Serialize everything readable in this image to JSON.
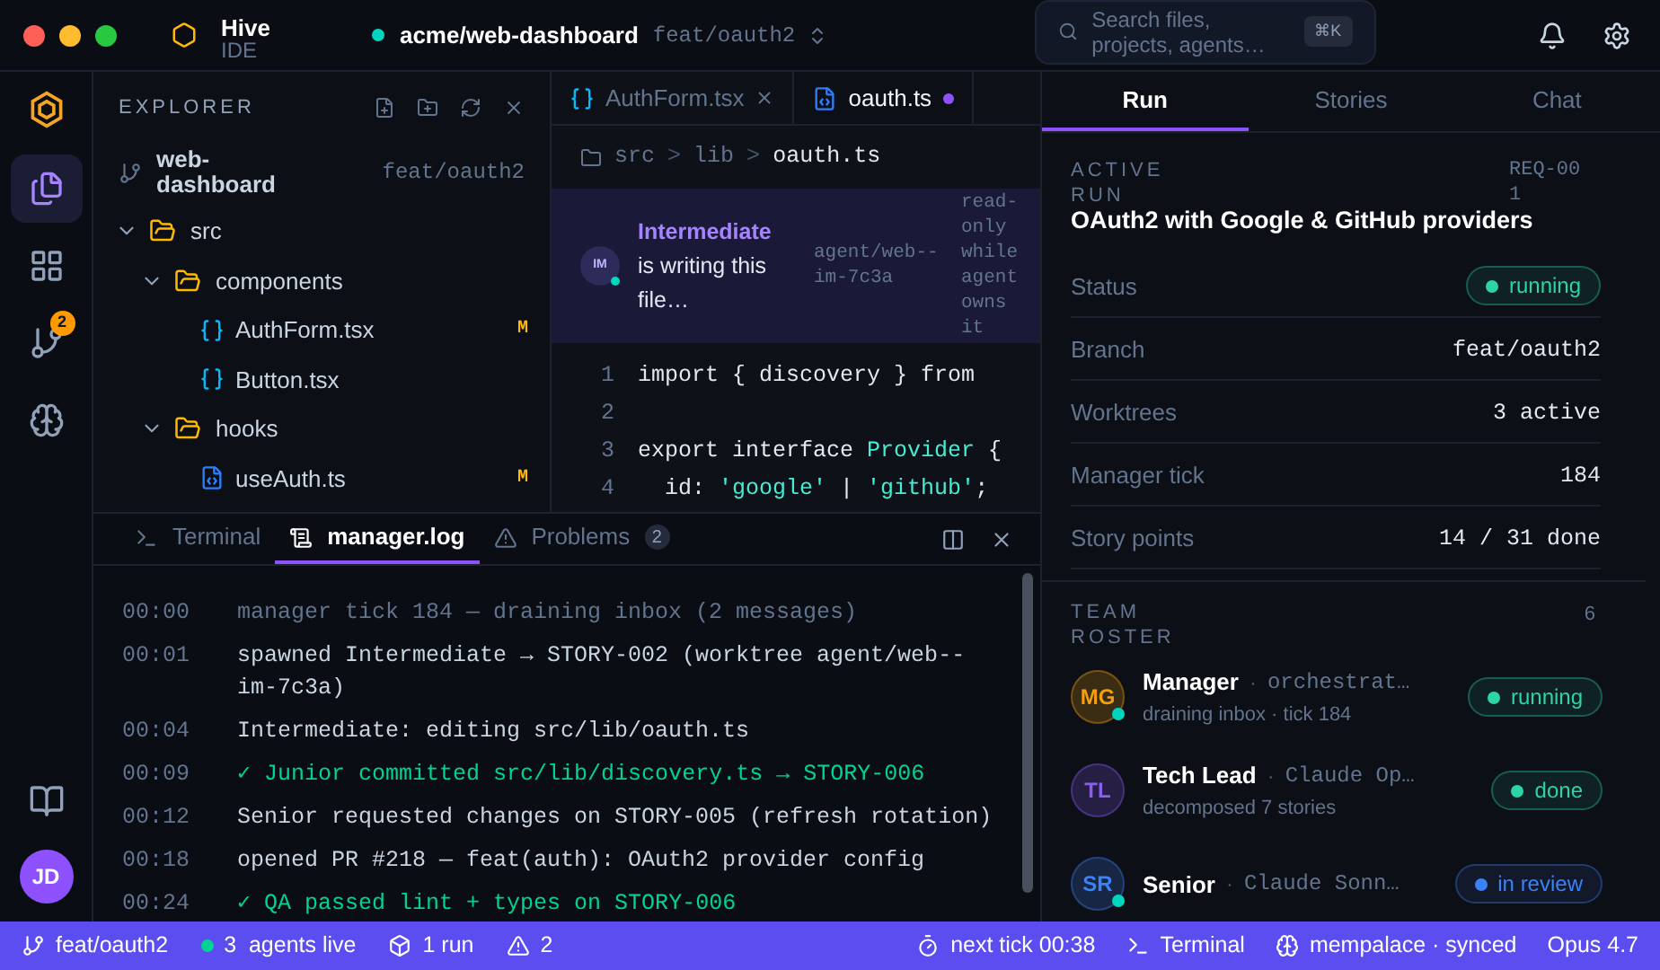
{
  "titlebar": {
    "app_name": "Hive",
    "app_sub": "IDE",
    "repo": "acme/web-dashboard",
    "branch": "feat/oauth2",
    "search": {
      "placeholder": "Search files, projects, agents…",
      "shortcut": "⌘K"
    }
  },
  "activity_bar": {
    "items": [
      {
        "kind": "files",
        "selected": true
      },
      {
        "kind": "grid",
        "selected": false
      },
      {
        "kind": "git",
        "selected": false,
        "badge": "2"
      },
      {
        "kind": "brain",
        "selected": false
      }
    ],
    "avatar": "JD"
  },
  "explorer": {
    "title": "EXPLORER",
    "project": "web-dashboard",
    "branch": "feat/oauth2",
    "tree": [
      {
        "name": "src",
        "kind": "folder",
        "expanded": true,
        "children": [
          {
            "name": "components",
            "kind": "folder",
            "expanded": true,
            "children": [
              {
                "name": "AuthForm.tsx",
                "kind": "tsx",
                "modified": "M"
              },
              {
                "name": "Button.tsx",
                "kind": "tsx"
              }
            ]
          },
          {
            "name": "hooks",
            "kind": "folder",
            "expanded": true,
            "children": [
              {
                "name": "useAuth.ts",
                "kind": "ts",
                "modified": "M"
              }
            ]
          }
        ]
      }
    ]
  },
  "editor": {
    "tabs": [
      {
        "name": "AuthForm.tsx",
        "kind": "tsx",
        "selected": false,
        "dirty": false
      },
      {
        "name": "oauth.ts",
        "kind": "ts",
        "selected": true,
        "dirty": true
      }
    ],
    "breadcrumb": [
      "src",
      "lib",
      "oauth.ts"
    ],
    "breadcrumb_separator": ">",
    "banner": {
      "avatar": "IM",
      "agent": "Intermediate",
      "message": "is writing this file…",
      "worktree": "agent/web--im-7c3a",
      "note": "read-only while agent owns it"
    },
    "lines": [
      {
        "number": "1",
        "tokens": [
          {
            "kind": "plain",
            "text": "import { discovery } from"
          }
        ]
      },
      {
        "number": "2"
      },
      {
        "number": "3",
        "tokens": [
          {
            "kind": "plain",
            "text": "export interface "
          },
          {
            "kind": "type",
            "text": "Provider"
          },
          {
            "kind": "plain",
            "text": " {"
          }
        ]
      },
      {
        "number": "4",
        "tokens": [
          {
            "kind": "plain",
            "text": "  id: "
          },
          {
            "kind": "string",
            "text": "'google'"
          },
          {
            "kind": "plain",
            "text": " | "
          },
          {
            "kind": "string",
            "text": "'github'"
          },
          {
            "kind": "plain",
            "text": ";"
          }
        ]
      }
    ]
  },
  "bottom_panel": {
    "tabs": [
      {
        "label": "Terminal",
        "kind": "terminal",
        "selected": false
      },
      {
        "label": "manager.log",
        "kind": "log",
        "selected": true
      },
      {
        "label": "Problems",
        "kind": "problems",
        "selected": false,
        "count": "2"
      }
    ],
    "log": [
      {
        "time": "00:00",
        "text": "manager tick 184 — draining inbox (2 messages)",
        "kind": "muted"
      },
      {
        "time": "00:01",
        "text": "spawned Intermediate → STORY-002 (worktree agent/web--im-7c3a)",
        "kind": "normal"
      },
      {
        "time": "00:04",
        "text": "Intermediate: editing src/lib/oauth.ts",
        "kind": "normal"
      },
      {
        "time": "00:09",
        "text": "✓ Junior committed src/lib/discovery.ts → STORY-006",
        "kind": "success"
      },
      {
        "time": "00:12",
        "text": "Senior requested changes on STORY-005 (refresh rotation)",
        "kind": "normal"
      },
      {
        "time": "00:18",
        "text": "opened PR #218 — feat(auth): OAuth2 provider config",
        "kind": "normal"
      },
      {
        "time": "00:24",
        "text": "✓ QA passed lint + types on STORY-006",
        "kind": "success"
      }
    ]
  },
  "right_panel": {
    "tabs": [
      {
        "label": "Run",
        "selected": true
      },
      {
        "label": "Stories",
        "selected": false
      },
      {
        "label": "Chat",
        "selected": false
      }
    ],
    "active_run": {
      "heading": "ACTIVE RUN",
      "id": "REQ-001",
      "title": "OAuth2 with Google & GitHub providers",
      "fields": [
        {
          "label": "Status",
          "kind": "status",
          "value": "running",
          "color": "#2dd4a8"
        },
        {
          "label": "Branch",
          "kind": "text",
          "value": "feat/oauth2"
        },
        {
          "label": "Worktrees",
          "kind": "text",
          "value": "3 active"
        },
        {
          "label": "Manager tick",
          "kind": "text",
          "value": "184"
        },
        {
          "label": "Story points",
          "kind": "text",
          "value": "14 / 31 done"
        }
      ]
    },
    "roster": {
      "heading": "TEAM ROSTER",
      "count": "6",
      "members": [
        {
          "initials": "MG",
          "name": "Manager",
          "separator": "·",
          "model": "orchestrat…",
          "detail": "draining inbox · tick 184",
          "status": "running",
          "color": "#2dd4a8",
          "online": true
        },
        {
          "initials": "TL",
          "name": "Tech Lead",
          "separator": "·",
          "model": "Claude Op…",
          "detail": "decomposed 7 stories",
          "status": "done",
          "color": "#2dd4a8",
          "online": false
        },
        {
          "initials": "SR",
          "name": "Senior",
          "separator": "·",
          "model": "Claude Sonn…",
          "status": "in review",
          "color": "#3b82f6",
          "online": true
        }
      ]
    }
  },
  "status_bar": {
    "left": [
      {
        "kind": "branch",
        "text": "feat/oauth2"
      },
      {
        "kind": "agents",
        "text": "3  agents live"
      },
      {
        "kind": "run",
        "text": "1 run"
      },
      {
        "kind": "warning",
        "text": "2"
      }
    ],
    "right": [
      {
        "kind": "timer",
        "text": "next tick 00:38"
      },
      {
        "kind": "terminal",
        "text": "Terminal"
      },
      {
        "kind": "memory",
        "text": "mempalace · synced"
      },
      {
        "kind": "model",
        "text": "Opus 4.7"
      }
    ]
  }
}
